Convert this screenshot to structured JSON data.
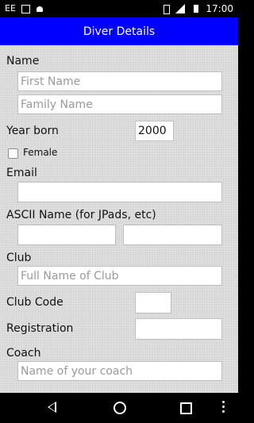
{
  "status_bar": {
    "carrier": "EE",
    "time": "17:00",
    "icons": [
      "image-icon",
      "android-icon",
      "vibrate-icon",
      "signal-icon",
      "battery-icon"
    ]
  },
  "app_bar": {
    "title": "Diver Details",
    "color": "#0000ff"
  },
  "form": {
    "name_label": "Name",
    "first_name_placeholder": "First Name",
    "family_name_placeholder": "Family Name",
    "year_born_label": "Year born",
    "year_born_value": "2000",
    "female_label": "Female",
    "email_label": "Email",
    "ascii_name_label": "ASCII Name (for JPads, etc)",
    "club_label": "Club",
    "club_placeholder": "Full Name of Club",
    "club_code_label": "Club Code",
    "registration_label": "Registration",
    "coach_label": "Coach",
    "coach_placeholder": "Name of your coach"
  },
  "nav_bar": {
    "icons": [
      "back-icon",
      "home-icon",
      "recent-apps-icon",
      "more-icon"
    ]
  }
}
